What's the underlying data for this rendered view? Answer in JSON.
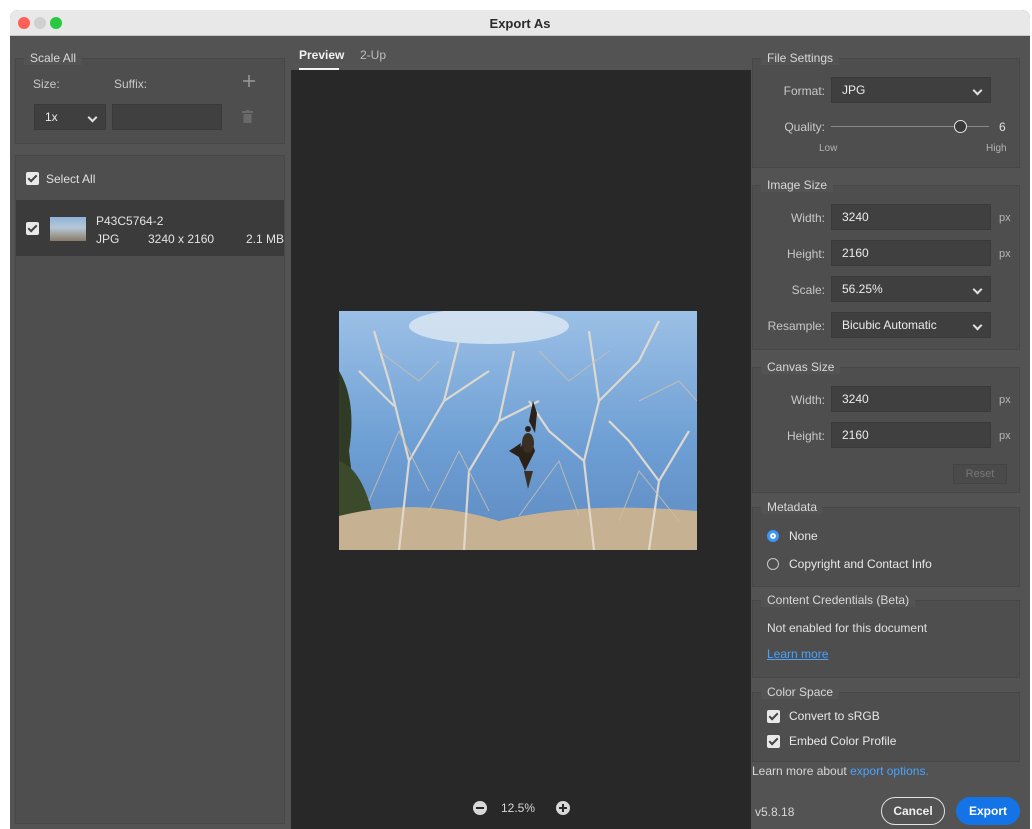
{
  "window": {
    "title": "Export As"
  },
  "left": {
    "scale_all": {
      "legend": "Scale All",
      "size_label": "Size:",
      "suffix_label": "Suffix:",
      "size_value": "1x",
      "suffix_value": ""
    },
    "select_all_label": "Select All",
    "file": {
      "name": "P43C5764-2",
      "format": "JPG",
      "dimensions": "3240 x 2160",
      "size": "2.1 MB"
    }
  },
  "center": {
    "tabs": [
      {
        "label": "Preview"
      },
      {
        "label": "2-Up"
      }
    ],
    "zoom": "12.5%"
  },
  "right": {
    "file_settings": {
      "legend": "File Settings",
      "format_label": "Format:",
      "format_value": "JPG",
      "quality_label": "Quality:",
      "quality_value": "6",
      "low_label": "Low",
      "high_label": "High"
    },
    "image_size": {
      "legend": "Image Size",
      "width_label": "Width:",
      "width_value": "3240",
      "height_label": "Height:",
      "height_value": "2160",
      "scale_label": "Scale:",
      "scale_value": "56.25%",
      "resample_label": "Resample:",
      "resample_value": "Bicubic Automatic",
      "unit": "px"
    },
    "canvas_size": {
      "legend": "Canvas Size",
      "width_label": "Width:",
      "width_value": "3240",
      "height_label": "Height:",
      "height_value": "2160",
      "unit": "px",
      "reset_label": "Reset"
    },
    "metadata": {
      "legend": "Metadata",
      "option_none": "None",
      "option_copyright": "Copyright and Contact Info"
    },
    "credentials": {
      "legend": "Content Credentials (Beta)",
      "status": "Not enabled for this document",
      "learn_more": "Learn more"
    },
    "color_space": {
      "legend": "Color Space",
      "convert_label": "Convert to sRGB",
      "embed_label": "Embed Color Profile"
    },
    "learn_more_prefix": "Learn more about ",
    "learn_more_link": "export options.",
    "version": "v5.8.18",
    "cancel_label": "Cancel",
    "export_label": "Export"
  }
}
